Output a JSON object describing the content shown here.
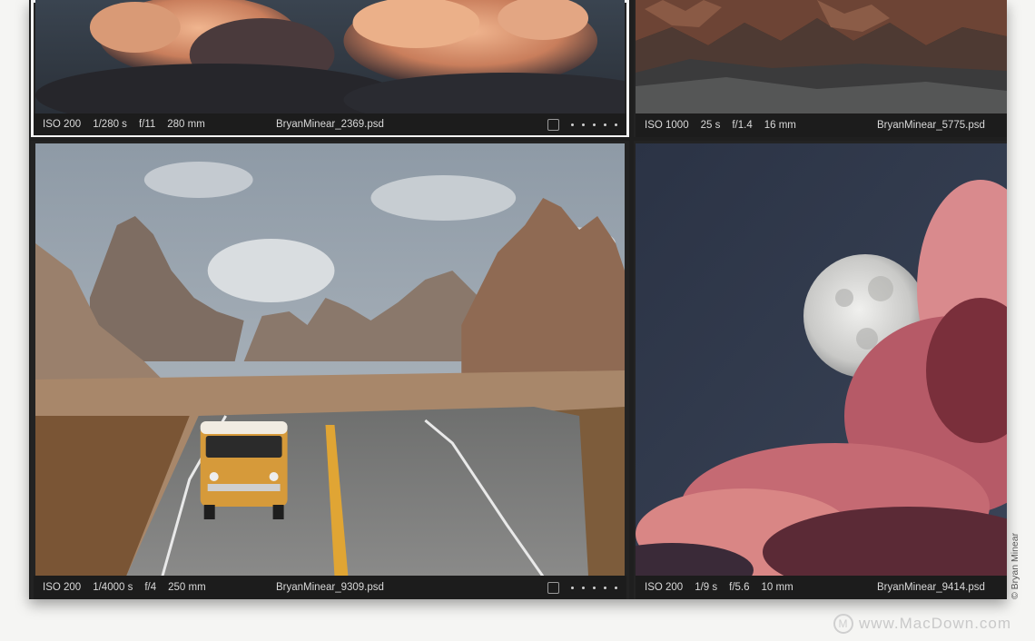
{
  "grid": {
    "cells": [
      {
        "iso": "ISO 200",
        "shutter": "1/280 s",
        "aperture": "f/11",
        "focal": "280 mm",
        "filename": "BryanMinear_2369.psd",
        "selected": true,
        "subject": "clouds"
      },
      {
        "iso": "ISO 1000",
        "shutter": "25 s",
        "aperture": "f/1.4",
        "focal": "16 mm",
        "filename": "BryanMinear_5775.psd",
        "selected": false,
        "subject": "rocky ridges"
      },
      {
        "iso": "ISO 200",
        "shutter": "1/4000 s",
        "aperture": "f/4",
        "focal": "250 mm",
        "filename": "BryanMinear_9309.psd",
        "selected": false,
        "subject": "van on desert road"
      },
      {
        "iso": "ISO 200",
        "shutter": "1/9 s",
        "aperture": "f/5.6",
        "focal": "10 mm",
        "filename": "BryanMinear_9414.psd",
        "selected": false,
        "subject": "moon and pink clouds"
      }
    ]
  },
  "credit": "© Bryan Minear",
  "watermark": {
    "text": "www.MacDown.com",
    "logo_letter": "M"
  },
  "colors": {
    "selection_outline": "#f3f3f3",
    "panel_bg": "#1f1f1f",
    "meta_text": "#d9d9d9"
  }
}
